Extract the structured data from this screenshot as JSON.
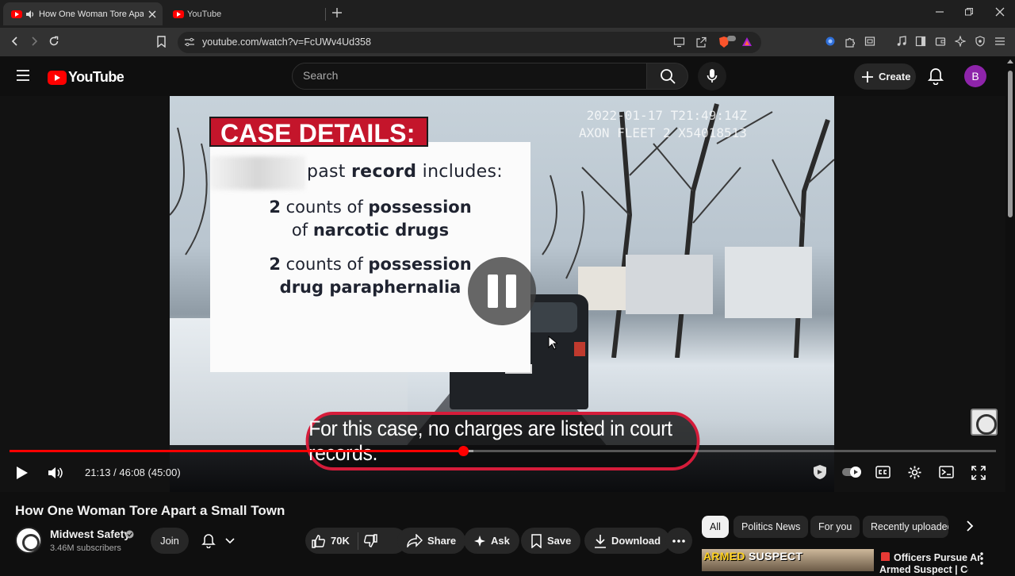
{
  "browser": {
    "tabs": [
      {
        "title": "How One Woman Tore Apart",
        "active": true,
        "audio": true
      },
      {
        "title": "YouTube",
        "active": false
      }
    ],
    "url": "youtube.com/watch?v=FcUWv4Ud358",
    "shield_badge": "99+"
  },
  "masthead": {
    "logo_text": "YouTube",
    "search_placeholder": "Search",
    "create_label": "Create",
    "avatar_letter": "B"
  },
  "player": {
    "overlay": {
      "banner": "CASE DETAILS:",
      "line1_pre": "past ",
      "line1_bold": "record",
      "line1_post": " includes:",
      "item1_num": "2",
      "item1_text": " counts of ",
      "item1_bold": "possession",
      "item1_line2_pre": "of ",
      "item1_line2_bold": "narcotic drugs",
      "item2_num": "2",
      "item2_text": " counts of ",
      "item2_bold": "possession",
      "item2_line2_bold": "drug paraphernalia"
    },
    "timestamp_line1": "2022-01-17 T21:49:14Z",
    "timestamp_line2": "AXON FLEET 2 X54018513",
    "caption": "For this case, no charges are listed in court records.",
    "time": "21:13 / 46:08 (45:00)",
    "progress_fraction": 0.46,
    "buffer_fraction": 0.47
  },
  "video": {
    "title": "How One Woman Tore Apart a Small Town",
    "channel": "Midwest Safety",
    "subscribers": "3.46M subscribers",
    "join_label": "Join",
    "likes": "70K",
    "share_label": "Share",
    "ask_label": "Ask",
    "save_label": "Save",
    "download_label": "Download"
  },
  "chips": [
    "All",
    "Politics News",
    "For you",
    "Recently uploaded"
  ],
  "recommendation": {
    "thumb_text_hl": "ARMED",
    "thumb_text": " SUSPECT",
    "title_line1": "Officers Pursue An",
    "title_line2": "Armed Suspect | Cop"
  },
  "colors": {
    "accent": "#ff0000",
    "banner": "#c4152b",
    "caption_border": "#d51c3a"
  }
}
